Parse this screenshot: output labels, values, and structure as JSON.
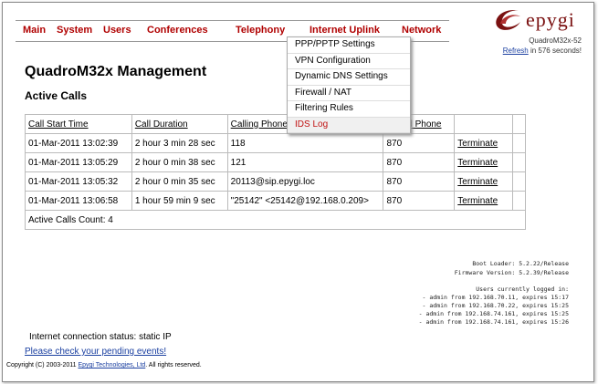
{
  "nav": {
    "items": [
      "Main",
      "System",
      "Users",
      "Conferences",
      "Telephony",
      "Internet Uplink",
      "Network"
    ]
  },
  "brand": {
    "logo": "epygi",
    "model": "QuadroM32x-52"
  },
  "refresh": {
    "link": "Refresh",
    "text": " in 576 seconds!"
  },
  "page": {
    "title": "QuadroM32x Management",
    "section": "Active Calls"
  },
  "dropdown": {
    "items": [
      "PPP/PPTP Settings",
      "VPN Configuration",
      "Dynamic DNS Settings",
      "Firewall / NAT",
      "Filtering Rules",
      "IDS Log"
    ]
  },
  "table": {
    "headers": [
      "Call Start Time",
      "Call Duration",
      "Calling Phone",
      "Called Phone"
    ],
    "rows": [
      {
        "start": "01-Mar-2011 13:02:39",
        "duration": "2 hour 3 min 28 sec",
        "calling": "118",
        "called": "870",
        "action": "Terminate"
      },
      {
        "start": "01-Mar-2011 13:05:29",
        "duration": "2 hour 0 min 38 sec",
        "calling": "121",
        "called": "870",
        "action": "Terminate"
      },
      {
        "start": "01-Mar-2011 13:05:32",
        "duration": "2 hour 0 min 35 sec",
        "calling": "20113@sip.epygi.loc",
        "called": "870",
        "action": "Terminate"
      },
      {
        "start": "01-Mar-2011 13:06:58",
        "duration": "1 hour 59 min 9 sec",
        "calling": "\"25142\" <25142@192.168.0.209>",
        "called": "870",
        "action": "Terminate"
      }
    ],
    "count": "Active Calls Count: 4"
  },
  "info": {
    "boot": "Boot Loader: 5.2.22/Release",
    "firmware": "Firmware Version: 5.2.39/Release",
    "users_header": "Users currently logged in:",
    "users": [
      "- admin from 192.168.70.11, expires 15:17",
      "- admin from 192.168.70.22, expires 15:25",
      "- admin from 192.168.74.161, expires 15:25",
      "- admin from 192.168.74.161, expires 15:26"
    ]
  },
  "footer": {
    "status": "Internet connection status: static IP",
    "pending": "Please check your pending events!",
    "copyright_pre": "Copyright (C) 2003-2011 ",
    "copyright_link": "Epygi Technologies, Ltd",
    "copyright_post": ". All rights reserved."
  },
  "colors": {
    "accent": "#b00000",
    "link": "#1a3fa0"
  }
}
